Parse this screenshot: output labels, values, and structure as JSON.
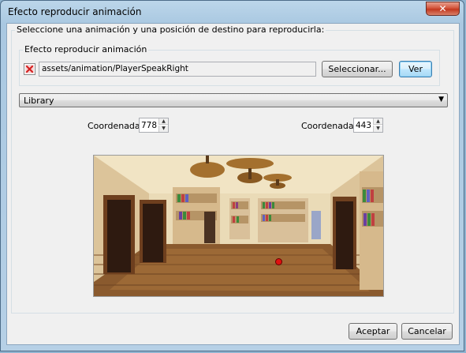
{
  "window": {
    "title": "Efecto reproducir animación",
    "close_symbol": "✕"
  },
  "group": {
    "instruction": "Seleccione una animación y una posición de destino para reproducirla:"
  },
  "animation": {
    "legend": "Efecto reproducir animación",
    "path": "assets/animation/PlayerSpeakRight",
    "status_icon": "error-x-icon",
    "select_label": "Seleccionar...",
    "view_label": "Ver"
  },
  "scene": {
    "selected": "Library"
  },
  "coords": {
    "x_label": "Coordenada X",
    "x_value": "778",
    "y_label": "Coordenada Y",
    "y_value": "443"
  },
  "buttons": {
    "accept": "Aceptar",
    "cancel": "Cancelar"
  },
  "colors": {
    "marker": "#e01010",
    "titlebar": "#a9c8e1"
  }
}
